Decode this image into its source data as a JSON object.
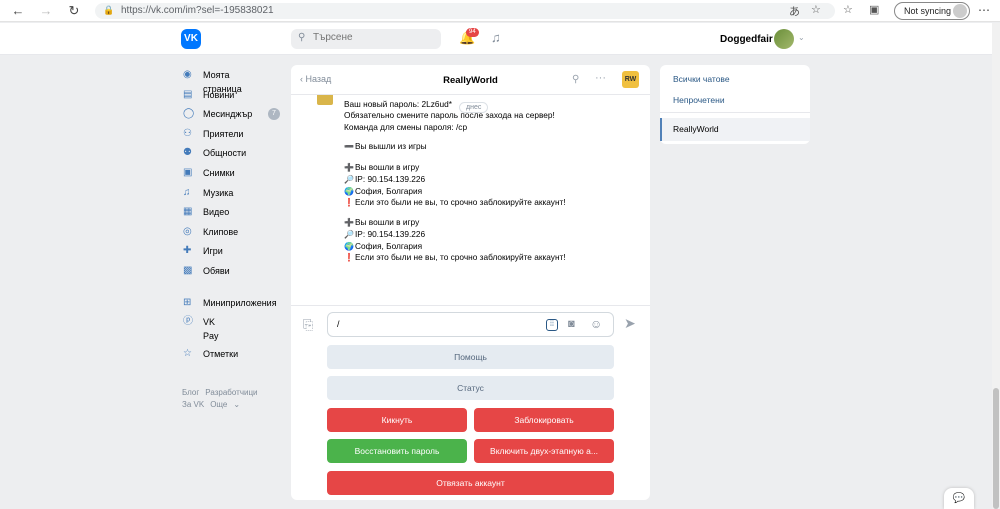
{
  "browser": {
    "url": "https://vk.com/im?sel=-195838021",
    "sync_label": "Not syncing",
    "nav_back": "←",
    "nav_forward": "→",
    "nav_reload": "↻",
    "nav_home": "⌂",
    "more_icon": "⋯"
  },
  "header": {
    "logo": "VK",
    "search_placeholder": "Търсене",
    "notifications_count": "94",
    "username": "Doggedfair"
  },
  "sidebar": {
    "items": [
      {
        "label": "Моята страница",
        "icon": "user-circle-icon"
      },
      {
        "label": "Новини",
        "icon": "news-icon"
      },
      {
        "label": "Месинджър",
        "icon": "message-icon",
        "count": "7"
      },
      {
        "label": "Приятели",
        "icon": "friends-icon"
      },
      {
        "label": "Общности",
        "icon": "communities-icon"
      },
      {
        "label": "Снимки",
        "icon": "photo-icon"
      },
      {
        "label": "Музика",
        "icon": "music-icon"
      },
      {
        "label": "Видео",
        "icon": "video-icon"
      },
      {
        "label": "Клипове",
        "icon": "clips-icon"
      },
      {
        "label": "Игри",
        "icon": "games-icon"
      },
      {
        "label": "Обяви",
        "icon": "ads-icon"
      }
    ],
    "items2": [
      {
        "label": "Миниприложения",
        "icon": "apps-icon"
      },
      {
        "label": "VK Pay",
        "icon": "vkpay-icon"
      }
    ],
    "items3": [
      {
        "label": "Отметки",
        "icon": "star-icon"
      }
    ],
    "footer": {
      "blog": "Блог",
      "dev": "Разработчици",
      "about": "За VK",
      "more": "Още"
    }
  },
  "chat": {
    "back_label": "Назад",
    "title": "ReallyWorld",
    "date_badge": "днес",
    "lines": [
      {
        "emoji": "",
        "text": "Ваш новый пароль: 2Lz6ud*"
      },
      {
        "emoji": "",
        "text": "Обязательно смените пароль после захода на сервер!"
      },
      {
        "emoji": "",
        "text": "Команда для смены пароля: /cp"
      },
      {
        "emoji": "➖",
        "text": "Вы вышли из игры"
      },
      {
        "emoji": "➕",
        "text": "Вы вошли в игру"
      },
      {
        "emoji": "🔎",
        "text": "IP: 90.154.139.226"
      },
      {
        "emoji": "🌍",
        "text": "София, Болгария"
      },
      {
        "emoji": "❗",
        "text": "Если это были не вы, то срочно заблокируйте аккаунт!"
      },
      {
        "emoji": "➕",
        "text": "Вы вошли в игру"
      },
      {
        "emoji": "🔎",
        "text": "IP: 90.154.139.226"
      },
      {
        "emoji": "🌍",
        "text": "София, Болгария"
      },
      {
        "emoji": "❗",
        "text": "Если это были не вы, то срочно заблокируйте аккаунт!"
      }
    ],
    "input_value": "/",
    "keyboard": {
      "help": "Помощь",
      "status": "Статус",
      "kick": "Кикнуть",
      "block": "Заблокировать",
      "restore": "Восстановить пароль",
      "twofa": "Включить двух-этапную а...",
      "unlink": "Отвязать аккаунт"
    }
  },
  "right_menu": {
    "all_chats": "Всички чатове",
    "unread": "Непрочетени",
    "selected": "ReallyWorld"
  },
  "colors": {
    "accent": "#0077ff",
    "red": "#e64646",
    "green": "#4bb34b",
    "link": "#2a5885"
  }
}
